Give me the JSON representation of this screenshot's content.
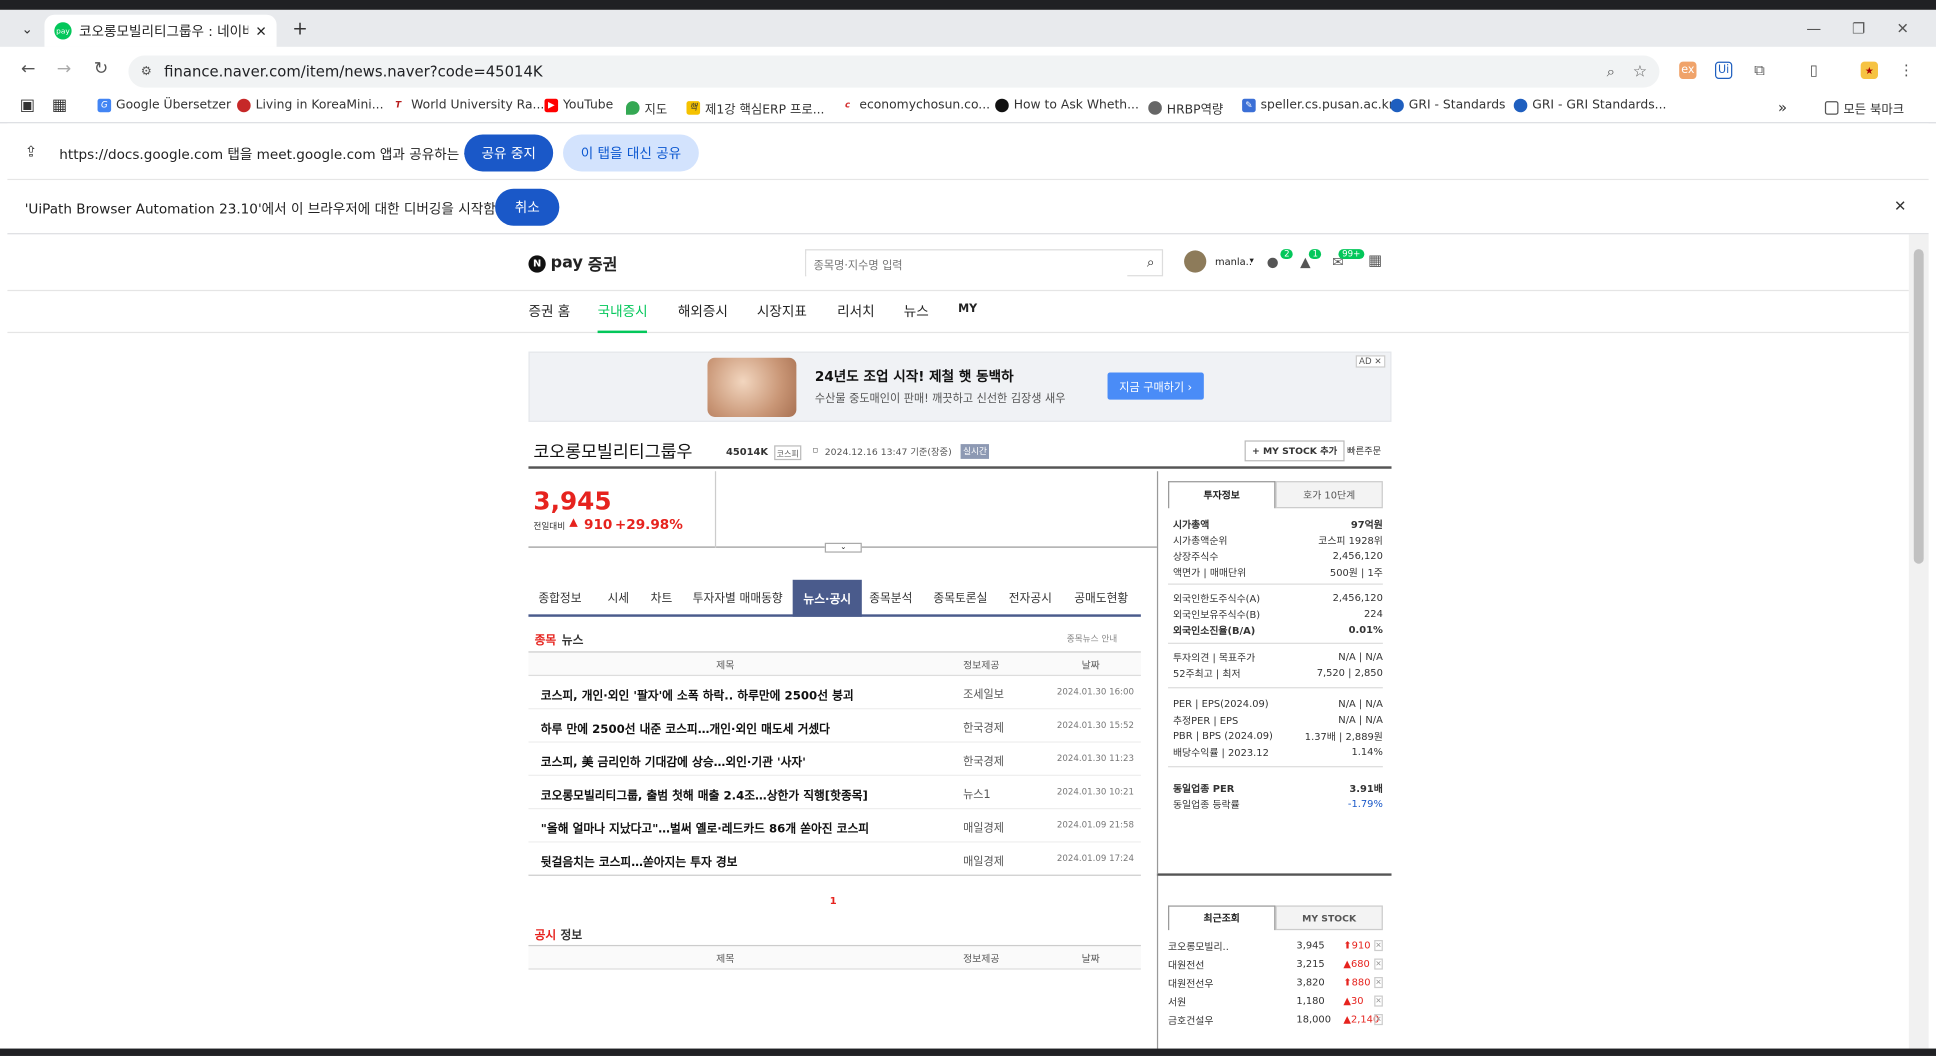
{
  "browser": {
    "tab_title": "코오롱모빌리티그룹우 : 네이버",
    "new_tab": "+",
    "url": "finance.naver.com/item/news.naver?code=45014K",
    "bookmarks": [
      "Google Übersetzer",
      "Living in KoreaMini...",
      "World University Ra...",
      "YouTube",
      "지도",
      "제1강 핵심ERP 프로...",
      "economychosun.co...",
      "How to Ask Wheth...",
      "HRBP역량",
      "speller.cs.pusan.ac.kr",
      "GRI - Standards",
      "GRI - GRI Standards..."
    ],
    "bookmarks_more": "»",
    "all_bookmarks": "모든 북마크"
  },
  "sharebar": {
    "text": "https://docs.google.com 탭을 meet.google.com 앱과 공유하는 중",
    "stop": "공유 중지",
    "share_instead": "이 탭을 대신 공유"
  },
  "debugbar": {
    "text": "'UiPath Browser Automation 23.10'에서 이 브라우저에 대한 디버깅을 시작함",
    "cancel": "취소",
    "close": "✕"
  },
  "site": {
    "logo_pay": "pay",
    "logo_stock": "증권",
    "search_placeholder": "종목명·지수명 입력",
    "user": "manla..",
    "badges": {
      "chat": "2",
      "bell": "1",
      "mail": "99+"
    },
    "nav": [
      "증권 홈",
      "국내증시",
      "해외증시",
      "시장지표",
      "리서치",
      "뉴스",
      "MY"
    ]
  },
  "ad": {
    "title": "24년도 조업 시작! 제철 햇 동백하",
    "desc": "수산물 중도매인이 판매! 깨끗하고 신선한 김장생 새우",
    "cta": "지금 구매하기 ›",
    "badge": "AD"
  },
  "stock": {
    "name": "코오롱모빌리티그룹우",
    "code": "45014K",
    "market": "코스피",
    "timestamp": "2024.12.16 13:47 기준(장중)",
    "realtime": "실시간",
    "mystock": "+ MY STOCK 추가",
    "quick_order": "빠른주문",
    "price": "3,945",
    "change_label": "전일대비",
    "change": "910",
    "change_pct": "+29.98%"
  },
  "subtabs": [
    "종합정보",
    "시세",
    "차트",
    "투자자별 매매동향",
    "뉴스·공시",
    "종목분석",
    "종목토론실",
    "전자공시",
    "공매도현황"
  ],
  "news": {
    "section_title_a": "종목",
    "section_title_b": "뉴스",
    "guide": "종목뉴스 안내",
    "headers": [
      "제목",
      "정보제공",
      "날짜"
    ],
    "rows": [
      {
        "title": "코스피, 개인·외인 '팔자'에 소폭 하락.. 하루만에 2500선 붕괴",
        "source": "조세일보",
        "date": "2024.01.30 16:00"
      },
      {
        "title": "하루 만에 2500선 내준 코스피…개인·외인 매도세 거셌다",
        "source": "한국경제",
        "date": "2024.01.30 15:52"
      },
      {
        "title": "코스피, 美 금리인하 기대감에 상승…외인·기관 '사자'",
        "source": "한국경제",
        "date": "2024.01.30 11:23"
      },
      {
        "title": "코오롱모빌리티그룹, 출범 첫해 매출 2.4조…상한가 직행[핫종목]",
        "source": "뉴스1",
        "date": "2024.01.30 10:21"
      },
      {
        "title": "\"올해 얼마나 지났다고\"…벌써 옐로·레드카드 86개 쏟아진 코스피",
        "source": "매일경제",
        "date": "2024.01.09 21:58"
      },
      {
        "title": "뒷걸음치는 코스피…쏟아지는 투자 경보",
        "source": "매일경제",
        "date": "2024.01.09 17:24"
      }
    ],
    "page": "1"
  },
  "disclosure": {
    "title_a": "공시",
    "title_b": "정보",
    "headers": [
      "제목",
      "정보제공",
      "날짜"
    ]
  },
  "invest": {
    "tabs": [
      "투자정보",
      "호가 10단계"
    ],
    "rows1": [
      {
        "k": "시가총액",
        "v": "97억원"
      },
      {
        "k": "시가총액순위",
        "v": "코스피 1928위"
      },
      {
        "k": "상장주식수",
        "v": "2,456,120"
      },
      {
        "k": "액면가 | 매매단위",
        "v": "500원 | 1주"
      }
    ],
    "rows2": [
      {
        "k": "외국인한도주식수(A)",
        "v": "2,456,120"
      },
      {
        "k": "외국인보유주식수(B)",
        "v": "224"
      },
      {
        "k": "외국인소진율(B/A)",
        "v": "0.01%"
      }
    ],
    "rows3": [
      {
        "k": "투자의견 | 목표주가",
        "v": "N/A | N/A"
      },
      {
        "k": "52주최고 | 최저",
        "v": "7,520 | 2,850"
      }
    ],
    "rows4": [
      {
        "k": "PER | EPS(2024.09)",
        "v": "N/A | N/A"
      },
      {
        "k": "추정PER | EPS",
        "v": "N/A | N/A"
      },
      {
        "k": "PBR | BPS (2024.09)",
        "v": "1.37배 | 2,889원"
      },
      {
        "k": "배당수익률 | 2023.12",
        "v": "1.14%"
      }
    ],
    "rows5": [
      {
        "k": "동일업종 PER",
        "v": "3.91배"
      },
      {
        "k": "동일업종 등락률",
        "v": "-1.79%"
      }
    ]
  },
  "recent": {
    "tabs": [
      "최근조회",
      "MY STOCK"
    ],
    "rows": [
      {
        "name": "코오롱모빌리..",
        "price": "3,945",
        "change": "910"
      },
      {
        "name": "대원전선",
        "price": "3,215",
        "change": "680"
      },
      {
        "name": "대원전선우",
        "price": "3,820",
        "change": "880"
      },
      {
        "name": "서원",
        "price": "1,180",
        "change": "30"
      },
      {
        "name": "금호건설우",
        "price": "18,000",
        "change": "2,140"
      }
    ]
  },
  "colors": {
    "up": "#e6231e",
    "naver_green": "#03c75a",
    "active_tab": "#4a5b8c",
    "blue": "#1a58c8"
  }
}
